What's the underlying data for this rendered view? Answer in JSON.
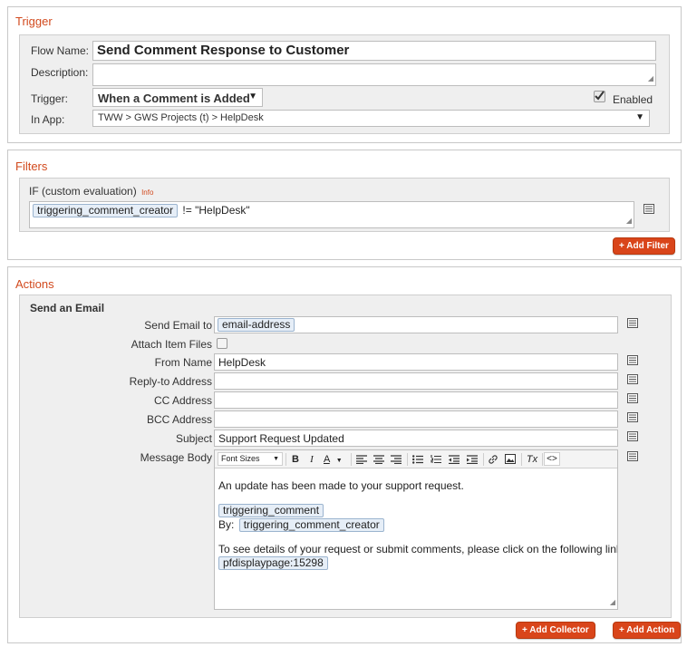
{
  "trigger": {
    "title": "Trigger",
    "flow_name_label": "Flow Name:",
    "flow_name_value": "Send Comment Response to Customer",
    "description_label": "Description:",
    "description_value": "",
    "trigger_label": "Trigger:",
    "trigger_value": "When a Comment is Added",
    "enabled_label": "Enabled",
    "enabled_checked": true,
    "in_app_label": "In App:",
    "in_app_value": "TWW > GWS Projects (t) > HelpDesk"
  },
  "filters": {
    "title": "Filters",
    "if_label": "IF (custom evaluation)",
    "info_label": "Info",
    "expression_token": "triggering_comment_creator",
    "expression_rest": "!= \"HelpDesk\"",
    "add_filter_label": "+ Add Filter"
  },
  "actions": {
    "title": "Actions",
    "email": {
      "heading": "Send an Email",
      "send_to_label": "Send Email to",
      "send_to_token": "email-address",
      "attach_label": "Attach Item Files",
      "from_name_label": "From Name",
      "from_name_value": "HelpDesk",
      "reply_to_label": "Reply-to Address",
      "reply_to_value": "",
      "cc_label": "CC Address",
      "cc_value": "",
      "bcc_label": "BCC Address",
      "bcc_value": "",
      "subject_label": "Subject",
      "subject_value": "Support Request Updated",
      "message_body_label": "Message Body",
      "toolbar": {
        "font_sizes": "Font Sizes",
        "bold": "B",
        "italic": "I",
        "font_color": "A",
        "clear_format": "Tx",
        "source": "<>"
      },
      "body": {
        "line1": "An update has been made to your support request.",
        "token_comment": "triggering_comment",
        "by_label": "By:",
        "token_creator": "triggering_comment_creator",
        "line3": "To see details of your request or submit comments, please click on the following link:",
        "token_page": "pfdisplaypage:15298"
      }
    },
    "add_collector_label": "+ Add Collector",
    "add_action_label": "+ Add Action"
  },
  "colors": {
    "accent": "#d24a1e",
    "button": "#d9451a",
    "panel": "#efefef",
    "token_bg": "#e6eef7"
  },
  "icons": [
    "list-icon",
    "checkmark-icon",
    "dropdown-arrow-icon",
    "resize-grip-icon"
  ]
}
